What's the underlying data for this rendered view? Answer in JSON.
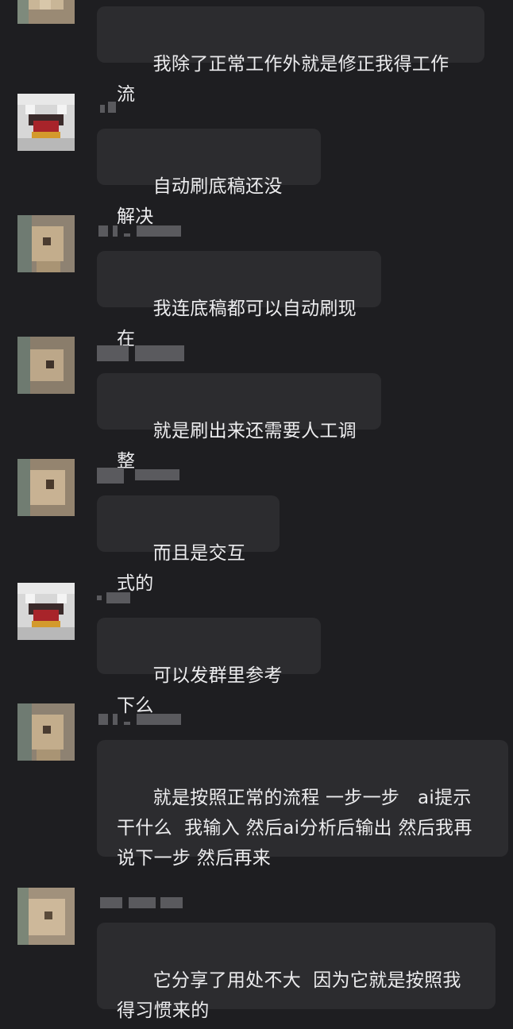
{
  "messages": [
    {
      "id": 1,
      "sender": "",
      "avatar": "dog-avatar",
      "text": "我除了正常工作外就是修正我得工作流"
    },
    {
      "id": 2,
      "sender": "",
      "avatar": "cat-avatar",
      "text": "自动刷底稿还没解决"
    },
    {
      "id": 3,
      "sender": "",
      "avatar": "dog-avatar",
      "text": "我连底稿都可以自动刷现在"
    },
    {
      "id": 4,
      "sender": "",
      "avatar": "dog-avatar",
      "text": "就是刷出来还需要人工调整"
    },
    {
      "id": 5,
      "sender": "",
      "avatar": "dog-avatar",
      "text": "而且是交互式的"
    },
    {
      "id": 6,
      "sender": "",
      "avatar": "cat-avatar",
      "text": "可以发群里参考下么"
    },
    {
      "id": 7,
      "sender": "",
      "avatar": "dog-avatar",
      "text": "就是按照正常的流程 一步一步   ai提示干什么  我输入 然后ai分析后输出 然后我再说下一步 然后再来"
    },
    {
      "id": 8,
      "sender": "",
      "avatar": "dog-avatar",
      "text": "它分享了用处不大  因为它就是按照我得习惯来的"
    }
  ]
}
